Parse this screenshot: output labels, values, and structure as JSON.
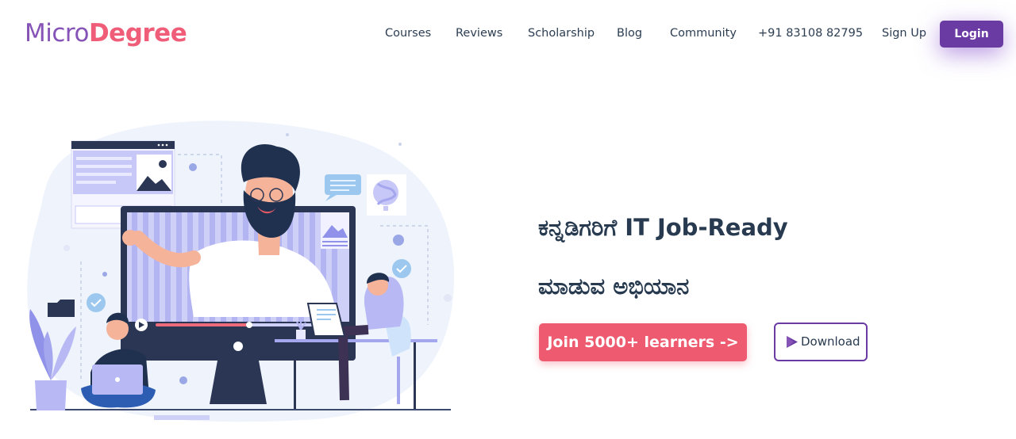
{
  "brand": {
    "logo_part1": "Micro",
    "logo_part2": "Degree"
  },
  "nav": {
    "courses": "Courses",
    "reviews": "Reviews",
    "scholarship": "Scholarship",
    "blog": "Blog",
    "community": "Community",
    "phone": "+91 83108 82795",
    "signup": "Sign Up",
    "login": "Login"
  },
  "hero": {
    "headline_line1": "ಕನ್ನಡಿಗರಿಗೆ IT Job-Ready",
    "headline_line2": "ಮಾಡುವ ಅಭಿಯಾನ",
    "join_button": "Join 5000+ learners ->",
    "download_button": "Download",
    "download_icon": "google-play-icon"
  },
  "colors": {
    "brand_purple": "#6a3ba3",
    "brand_pink": "#ef5d78",
    "logo_purple": "#8653b6",
    "heading_navy": "#273a4f"
  }
}
